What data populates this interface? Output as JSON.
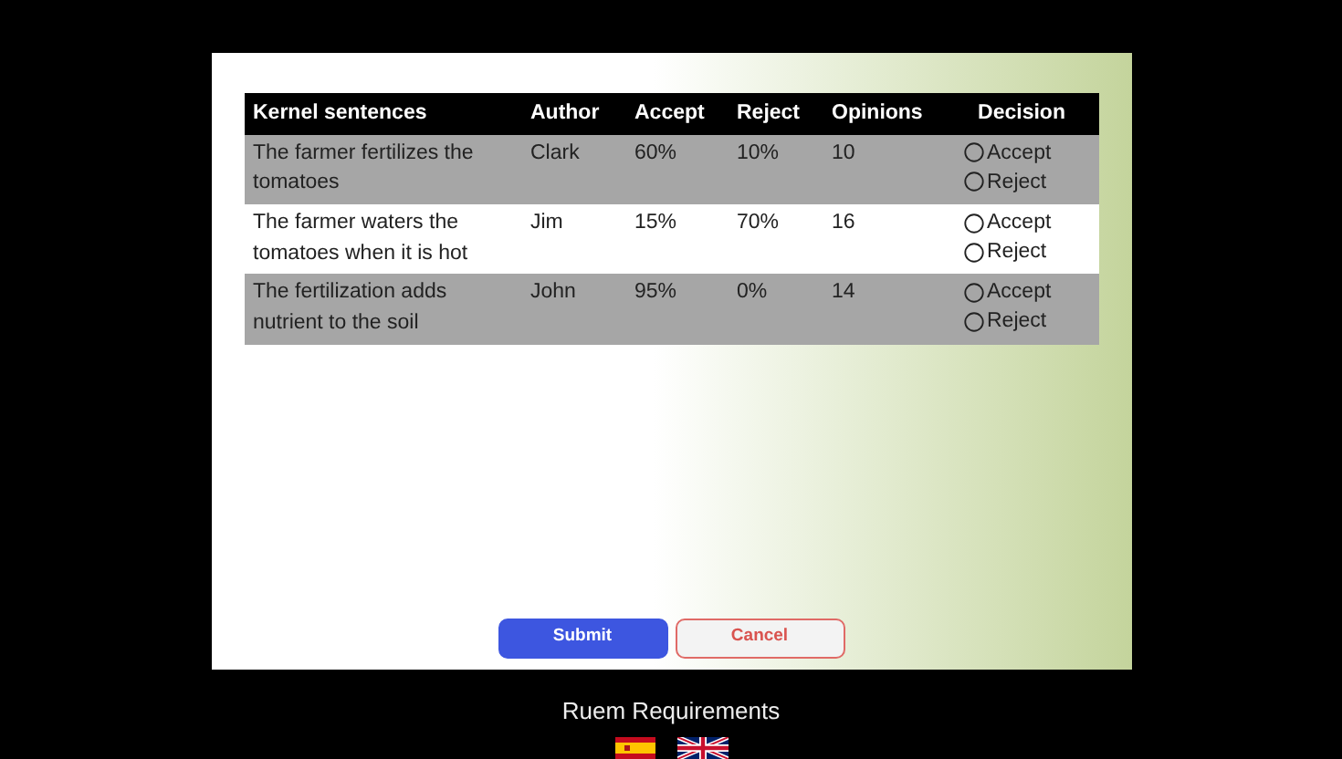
{
  "table": {
    "columns": [
      "Kernel sentences",
      "Author",
      "Accept",
      "Reject",
      "Opinions",
      "Decision"
    ],
    "rows": [
      {
        "sentence": "The farmer fertilizes the tomatoes",
        "author": "Clark",
        "accept": "60%",
        "reject": "10%",
        "opinions": "10",
        "shaded": true,
        "decision": [
          {
            "label": "Accept",
            "selected": false
          },
          {
            "label": "Reject",
            "selected": false
          }
        ]
      },
      {
        "sentence": "The farmer waters the tomatoes when it is hot",
        "author": "Jim",
        "accept": "15%",
        "reject": "70%",
        "opinions": "16",
        "shaded": false,
        "decision": [
          {
            "label": "Accept",
            "selected": false
          },
          {
            "label": "Reject",
            "selected": false
          }
        ]
      },
      {
        "sentence": "The fertilization adds nutrient to the soil",
        "author": "John",
        "accept": "95%",
        "reject": "0%",
        "opinions": "14",
        "shaded": true,
        "decision": [
          {
            "label": "Accept",
            "selected": false
          },
          {
            "label": "Reject",
            "selected": false
          }
        ]
      }
    ]
  },
  "buttons": [
    {
      "label": "Submit",
      "kind": "primary"
    },
    {
      "label": "Cancel",
      "kind": "outline"
    }
  ],
  "footer": {
    "title": "Ruem Requirements",
    "flags": [
      {
        "kind": "spain"
      },
      {
        "kind": "uk"
      }
    ]
  }
}
